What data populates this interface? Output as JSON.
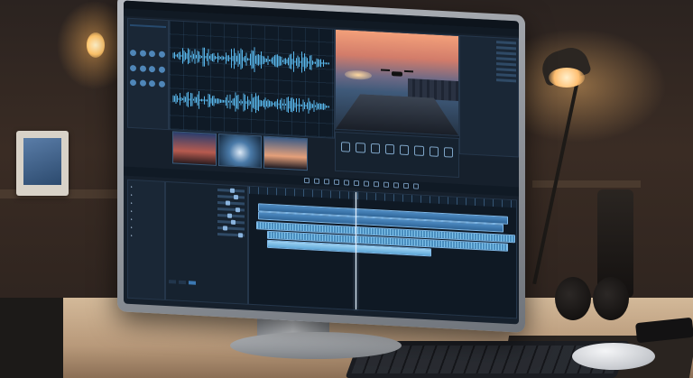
{
  "scene": {
    "description_label": "",
    "monitor": {
      "app": {
        "titlebar": {
          "title": ""
        },
        "menubar": {
          "items": []
        },
        "left_panel": {
          "title": "",
          "selected_item": ""
        },
        "preview": {
          "title": ""
        },
        "tracks": {
          "header": "",
          "names": []
        },
        "properties": {
          "rows": [
            {
              "label": "",
              "level": 0.55
            },
            {
              "label": "",
              "level": 0.7
            },
            {
              "label": "",
              "level": 0.35
            },
            {
              "label": "",
              "level": 0.8
            },
            {
              "label": "",
              "level": 0.45
            },
            {
              "label": "",
              "level": 0.6
            },
            {
              "label": "",
              "level": 0.25
            },
            {
              "label": "",
              "level": 0.9
            }
          ],
          "buttons": [
            "",
            "",
            ""
          ]
        },
        "timeline": {
          "playhead_label": ""
        }
      }
    },
    "accent_colors": {
      "ui_blue": "#3c79b3",
      "waveform": "#58b6ea",
      "lamp_glow": "#ffbe70"
    },
    "icons": [
      "drone-icon",
      "play-icon",
      "effect-icon",
      "track-icon"
    ]
  }
}
